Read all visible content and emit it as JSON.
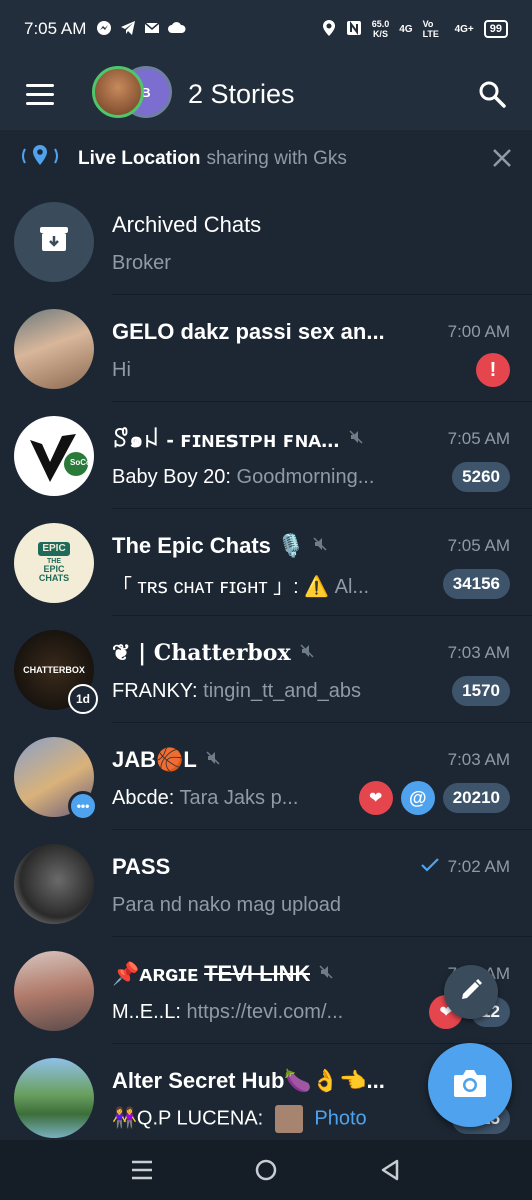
{
  "status_bar": {
    "time": "7:05 AM",
    "net_speed_value": "65.0",
    "net_speed_unit": "K/S",
    "sig1": "4G",
    "sig2": "Vo LTE",
    "sig3": "4G+",
    "battery": "99"
  },
  "app_bar": {
    "title": "2 Stories",
    "story_b_initial": "B"
  },
  "live_location": {
    "label": "Live Location",
    "detail": "sharing with Gks"
  },
  "chats": [
    {
      "name": "Archived Chats",
      "preview": "Broker"
    },
    {
      "name": "GELO dakz passi sex an...",
      "time": "7:00 AM",
      "preview": "Hi"
    },
    {
      "name": "ꑄ๑ꈤ - ꜰɪɴᴇꜱᴛᴘʜ ꜰɴᴀ...",
      "time": "7:05 AM",
      "sender": "Baby Boy 20:",
      "preview": " Goodmorning...",
      "badge": "5260"
    },
    {
      "name": "The Epic Chats 🎙️",
      "time": "7:05 AM",
      "sender": "「 ᴛʀꜱ ᴄʜᴀᴛ ꜰɪɢʜᴛ 」: ⚠️",
      "preview": " Al...",
      "badge": "34156"
    },
    {
      "name": "❦ | 𝐂𝐡𝐚𝐭𝐭𝐞𝐫𝐛𝐨𝐱",
      "time": "7:03 AM",
      "sender": "FRANKY:",
      "preview": " tingin_tt_and_abs",
      "badge": "1570",
      "story_label": "1d"
    },
    {
      "name": "JAB🏀L",
      "time": "7:03 AM",
      "sender": "Abcde:",
      "preview": " Tara Jaks p...",
      "badge": "20210"
    },
    {
      "name": "PASS",
      "time": "7:02 AM",
      "preview": "Para nd nako mag upload"
    },
    {
      "name": "📌ᴀʀɢɪᴇ ",
      "name_strike": "TEVI LINK",
      "time": "7:0_ AM",
      "sender": "M..E..L:",
      "preview": " https://tevi.com/...",
      "badge": "12"
    },
    {
      "name": "Alter Secret Hub🍆👌👈...",
      "sender": "👭Q.P LUCENA:",
      "photo_label": "Photo",
      "badge": "1525"
    }
  ],
  "avatars": {
    "chatterbox_text": "CHATTERBOX",
    "epic_text_top": "EPIC",
    "epic_text_mid": "THE",
    "epic_text_bottom": "EPIC CHATS",
    "soco_text": "SoCo"
  }
}
